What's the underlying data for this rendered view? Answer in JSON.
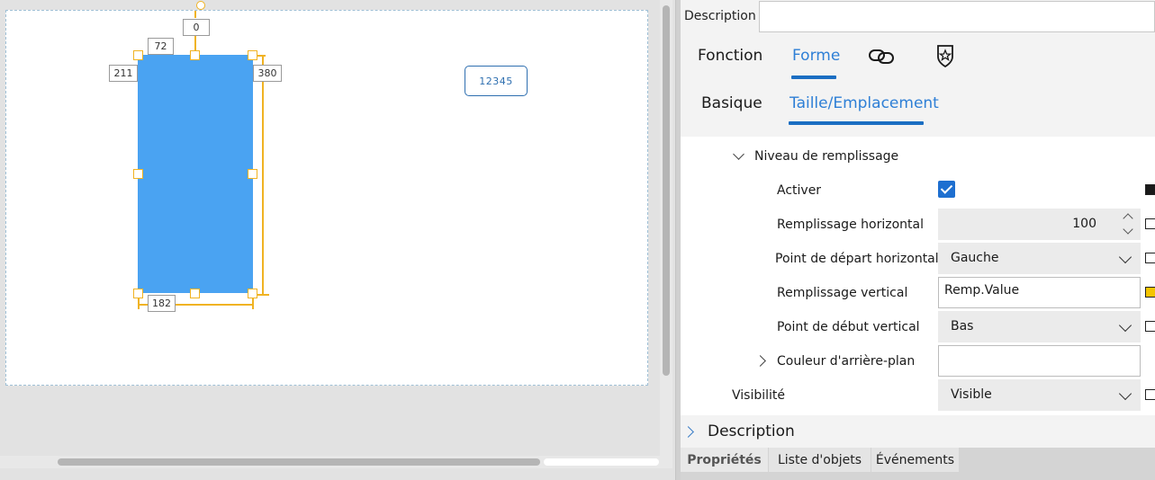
{
  "canvas": {
    "dimensions": {
      "top": "0",
      "width": "72",
      "left": "211",
      "right": "380",
      "height": "182"
    },
    "textbox_value": "12345"
  },
  "panel": {
    "description_label": "Description",
    "description_value": "",
    "main_tabs": [
      {
        "label": "Fonction",
        "active": false
      },
      {
        "label": "Forme",
        "active": true
      }
    ],
    "main_tab_icons": [
      "link-icon",
      "star-shield-icon"
    ],
    "sub_tabs": [
      {
        "label": "Basique",
        "active": false
      },
      {
        "label": "Taille/Emplacement",
        "active": true
      }
    ],
    "properties": {
      "fill_level_group": "Niveau de remplissage",
      "enable_label": "Activer",
      "enable_checked": true,
      "horizontal_fill_label": "Remplissage horizontal",
      "horizontal_fill_value": "100",
      "horizontal_start_label": "Point de départ horizontal",
      "horizontal_start_value": "Gauche",
      "vertical_fill_label": "Remplissage vertical",
      "vertical_fill_value": "Remp.Value",
      "vertical_start_label": "Point de début vertical",
      "vertical_start_value": "Bas",
      "background_color_label": "Couleur d'arrière-plan",
      "background_color_value": "",
      "visibility_label": "Visibilité",
      "visibility_value": "Visible"
    },
    "description_section_label": "Description",
    "bottom_tabs": [
      {
        "label": "Propriétés",
        "active": true
      },
      {
        "label": "Liste d'objets",
        "active": false
      },
      {
        "label": "Événements",
        "active": false
      }
    ]
  },
  "colors": {
    "shape_fill": "#4aa3f2",
    "selection": "#f0b323",
    "accent": "#2e7fd6",
    "checkbox": "#1e6fd0",
    "link_marker": "#f5c400"
  }
}
